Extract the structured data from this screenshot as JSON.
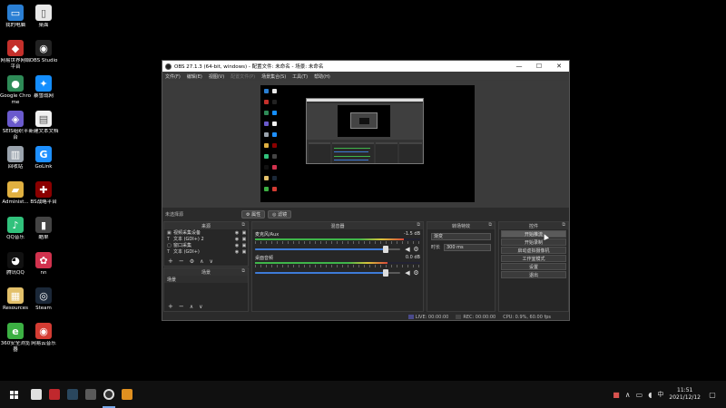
{
  "desktop": {
    "icons": [
      {
        "label": "我的电脑",
        "icon": "computer-icon",
        "color": "#2a7fd4",
        "glyph": "▭"
      },
      {
        "label": "桌面",
        "icon": "folder-icon",
        "color": "#e8e8e8",
        "glyph": "▯"
      },
      {
        "label": "网易世界网络平台",
        "icon": "netease-platform-icon",
        "color": "#c4302b",
        "glyph": "◆"
      },
      {
        "label": "OBS Studio",
        "icon": "obs-icon",
        "color": "#222222",
        "glyph": "◉"
      },
      {
        "label": "Google Chrome",
        "icon": "chrome-icon",
        "color": "#2e8b57",
        "glyph": "●"
      },
      {
        "label": "暴雪战网",
        "icon": "battlenet-icon",
        "color": "#148eff",
        "glyph": "✦"
      },
      {
        "label": "SEIS组织平台",
        "icon": "seis-platform-icon",
        "color": "#6a5acd",
        "glyph": "◈"
      },
      {
        "label": "新建文本文档",
        "icon": "text-file-icon",
        "color": "#f0f0f0",
        "glyph": "▤"
      },
      {
        "label": "回收站",
        "icon": "recycle-bin-icon",
        "color": "#9aa3ad",
        "glyph": "▥"
      },
      {
        "label": "GoLink",
        "icon": "golink-icon",
        "color": "#1e90ff",
        "glyph": "G"
      },
      {
        "label": "Administ...",
        "icon": "user-folder-icon",
        "color": "#e0b040",
        "glyph": "▰"
      },
      {
        "label": "BS战略平台",
        "icon": "bs-platform-icon",
        "color": "#8b0000",
        "glyph": "✚"
      },
      {
        "label": "QQ音乐",
        "icon": "qqmusic-icon",
        "color": "#31c27c",
        "glyph": "♪"
      },
      {
        "label": "酷单",
        "icon": "kudan-icon",
        "color": "#444444",
        "glyph": "▮"
      },
      {
        "label": "腾讯QQ",
        "icon": "qq-icon",
        "color": "#111111",
        "glyph": "◕"
      },
      {
        "label": "nn",
        "icon": "nn-icon",
        "color": "#d1324e",
        "glyph": "✿"
      },
      {
        "label": "Resources",
        "icon": "resources-icon",
        "color": "#e3c06a",
        "glyph": "▦"
      },
      {
        "label": "Steam",
        "icon": "steam-icon",
        "color": "#1b2838",
        "glyph": "◎"
      },
      {
        "label": "360安全浏览器",
        "icon": "360-browser-icon",
        "color": "#3cb043",
        "glyph": "e"
      },
      {
        "label": "网易云音乐",
        "icon": "netease-music-icon",
        "color": "#d43c33",
        "glyph": "◉"
      }
    ]
  },
  "obs": {
    "title": "OBS 27.1.3 (64-bit, windows) - 配置文件: 未命名 - 场景: 未命名",
    "window_buttons": {
      "minimize": "—",
      "maximize": "☐",
      "close": "✕"
    },
    "menu": [
      {
        "label": "文件(F)",
        "enabled": true
      },
      {
        "label": "编辑(E)",
        "enabled": true
      },
      {
        "label": "视图(V)",
        "enabled": true
      },
      {
        "label": "配置文件(P)",
        "enabled": false
      },
      {
        "label": "场景集合(S)",
        "enabled": true
      },
      {
        "label": "工具(T)",
        "enabled": true
      },
      {
        "label": "帮助(H)",
        "enabled": true
      }
    ],
    "source_bar": {
      "no_selection": "未选择源",
      "properties": "属性",
      "filters": "滤镜"
    },
    "sources": {
      "title": "来源",
      "items": [
        {
          "type_icon": "▣",
          "name": "视频采集设备"
        },
        {
          "type_icon": "T",
          "name": "文本 (GDI+) 2"
        },
        {
          "type_icon": "▢",
          "name": "窗口采集"
        },
        {
          "type_icon": "T",
          "name": "文本 (GDI+)"
        }
      ]
    },
    "scenes": {
      "title": "场景",
      "items": [
        "场景"
      ]
    },
    "mixer": {
      "title": "混音器",
      "tracks": [
        {
          "name": "麦克风/Aux",
          "db_label": "-1.5 dB",
          "level_db": -6,
          "volume_fraction": 0.9
        },
        {
          "name": "桌面音频",
          "db_label": "0.0 dB",
          "level_db": -12,
          "volume_fraction": 0.9
        }
      ]
    },
    "transitions": {
      "title": "转场特效",
      "selected": "渐变",
      "duration_label": "时长",
      "duration_value": "300 ms"
    },
    "controls": {
      "title": "控件",
      "buttons": [
        "开始推流",
        "开始录制",
        "启动虚拟摄像机",
        "工作室模式",
        "设置",
        "退出"
      ]
    },
    "status": {
      "live": "LIVE: 00:00:00",
      "rec": "REC: 00:00:00",
      "cpu": "CPU: 0.9%, 60.00 fps"
    }
  },
  "taskbar": {
    "apps": [
      {
        "icon": "store-icon",
        "color": "#e0e0e0"
      },
      {
        "icon": "netease-game-icon",
        "color": "#c0282d"
      },
      {
        "icon": "steam-taskbar-icon",
        "color": "#2a475e"
      },
      {
        "icon": "thunder-icon",
        "color": "#5a5a5a"
      },
      {
        "icon": "obs-taskbar-icon",
        "color": "#333333",
        "active": true
      },
      {
        "icon": "notepad-icon",
        "color": "#e09020"
      }
    ],
    "tray": {
      "ime": "中",
      "time": "11:51",
      "date": "2021/12/12"
    }
  }
}
